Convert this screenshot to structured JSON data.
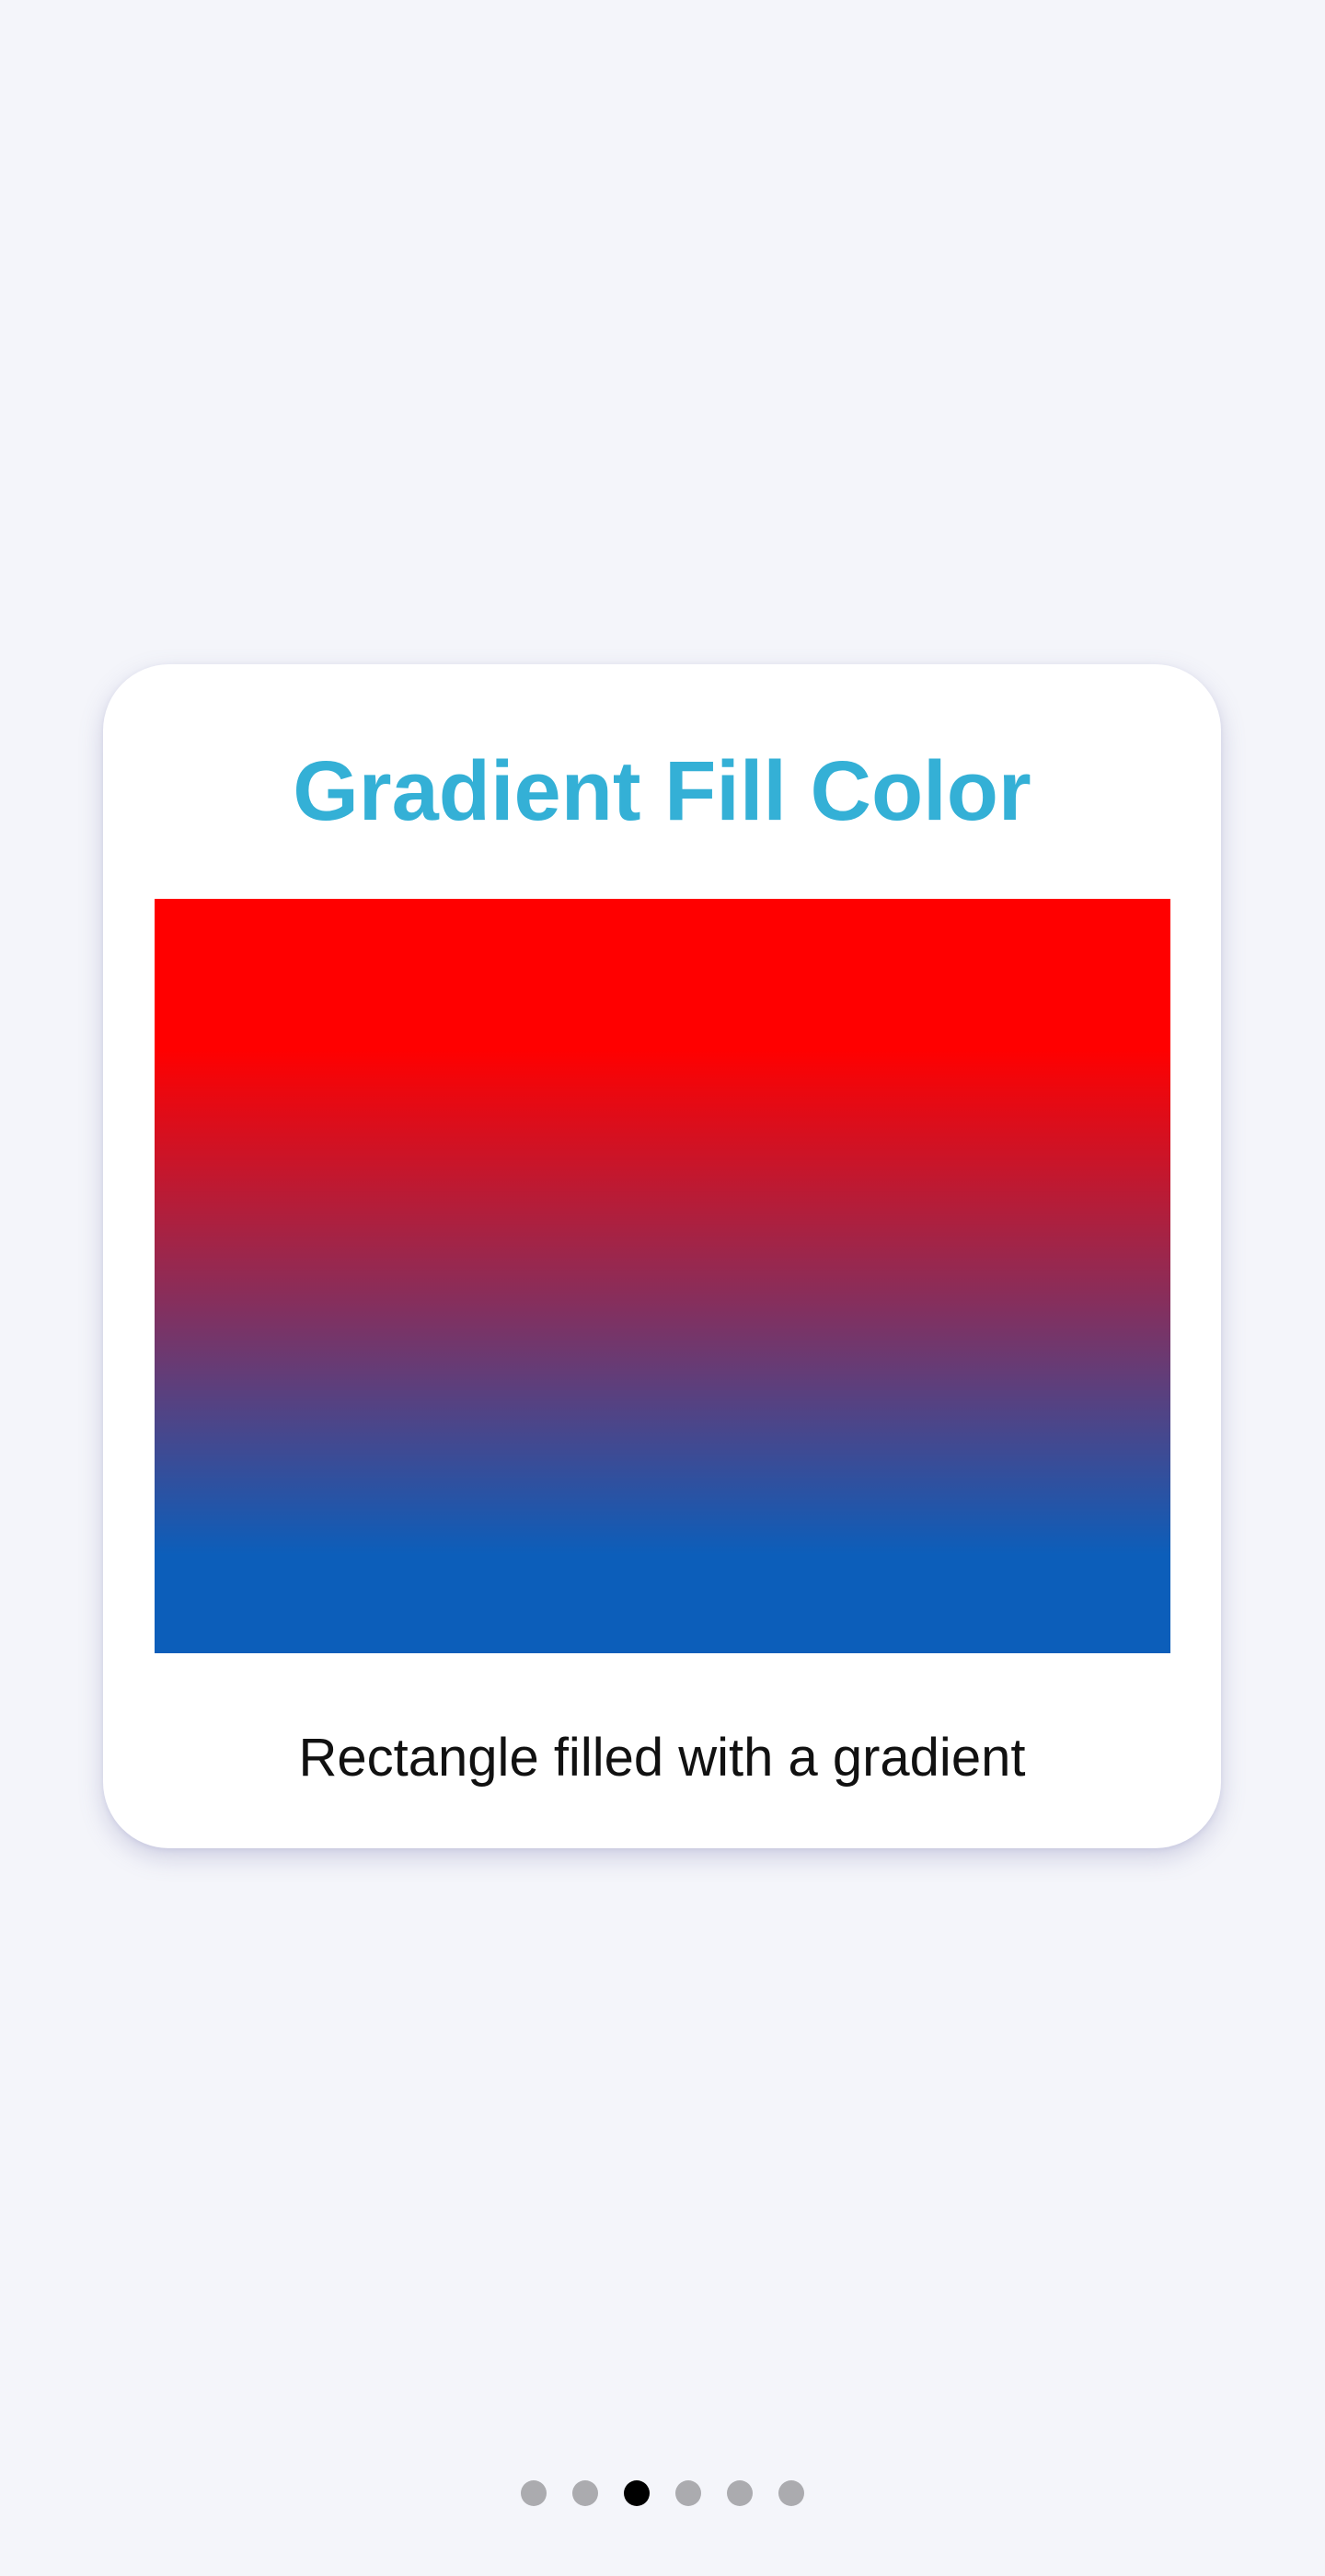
{
  "card": {
    "title": "Gradient Fill Color",
    "caption": "Rectangle filled with a gradient",
    "title_color": "#34b0d6",
    "gradient": {
      "direction": "top-to-bottom",
      "start_color": "#ff0000",
      "end_color": "#0c5eba"
    }
  },
  "pager": {
    "page_count": 6,
    "current_page": 3,
    "inactive_color": "#ababaf",
    "active_color": "#000000"
  }
}
